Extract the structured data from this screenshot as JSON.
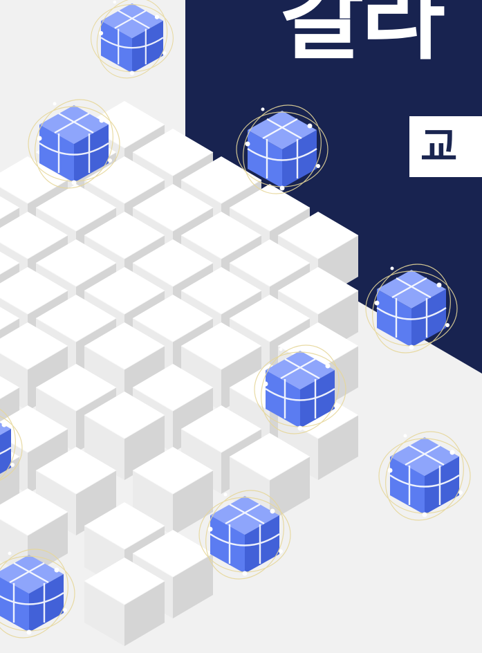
{
  "heading": "갈라",
  "badge": "교",
  "colors": {
    "navy": "#182350",
    "cube_blue": "#5b7cf1",
    "cube_blue_light": "#8ea5fb",
    "cube_blue_dark": "#4261d8",
    "white_block": "#ffffff",
    "gray_block": "#d9d9d9",
    "background_light": "#f1f1f1"
  },
  "icons": [
    "network-cube-icon"
  ]
}
